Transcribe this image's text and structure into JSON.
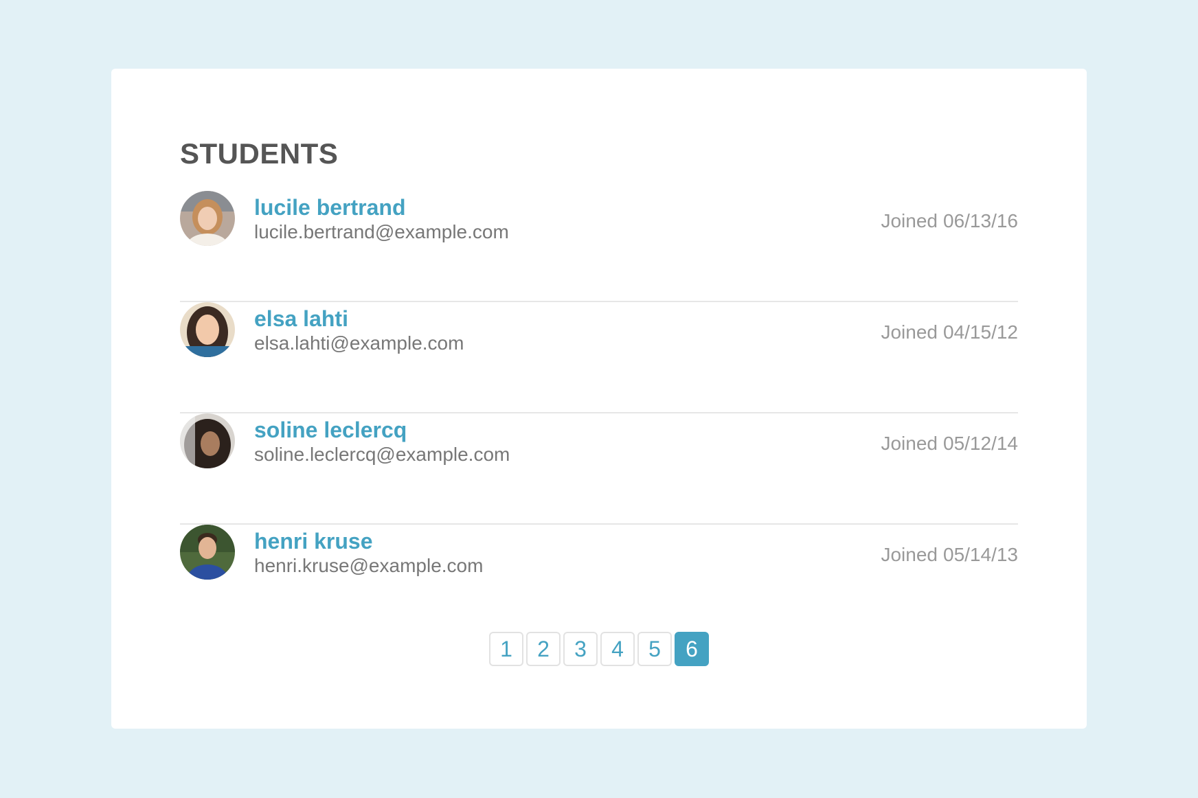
{
  "title": "STUDENTS",
  "joined_label": "Joined",
  "students": [
    {
      "name": "lucile bertrand",
      "email": "lucile.bertrand@example.com",
      "joined": "06/13/16"
    },
    {
      "name": "elsa lahti",
      "email": "elsa.lahti@example.com",
      "joined": "04/15/12"
    },
    {
      "name": "soline leclercq",
      "email": "soline.leclercq@example.com",
      "joined": "05/12/14"
    },
    {
      "name": "henri kruse",
      "email": "henri.kruse@example.com",
      "joined": "05/14/13"
    }
  ],
  "pagination": {
    "pages": [
      "1",
      "2",
      "3",
      "4",
      "5",
      "6"
    ],
    "current": "6"
  },
  "colors": {
    "background": "#e2f1f6",
    "card": "#ffffff",
    "accent": "#44a2c2",
    "title": "#555555",
    "email": "#777777",
    "joined": "#999999"
  }
}
